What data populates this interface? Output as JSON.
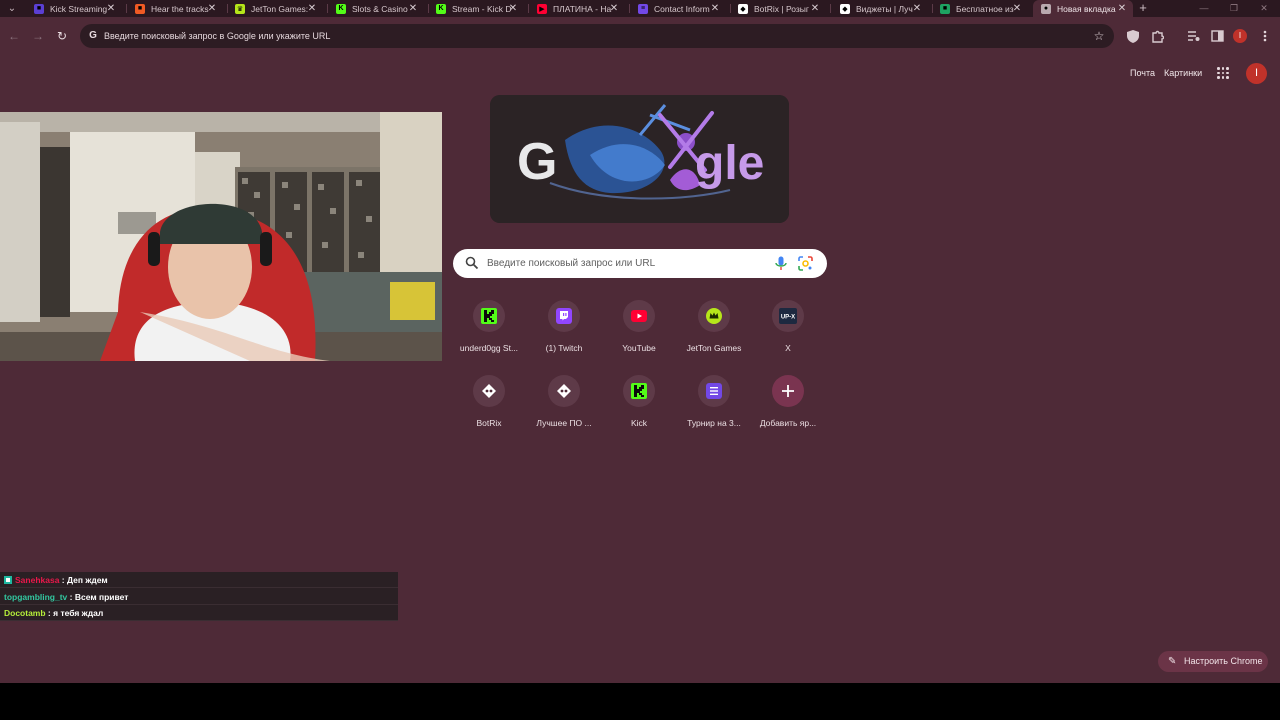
{
  "browser": {
    "tabs": [
      {
        "title": "Kick Streaming",
        "favicon_color": "#5b3fd3",
        "glyph": "■",
        "active": false
      },
      {
        "title": "Hear the tracks",
        "favicon_color": "#f15a24",
        "glyph": "■",
        "active": false
      },
      {
        "title": "JetTon Games:",
        "favicon_color": "#b6e61a",
        "glyph": "♛",
        "active": false
      },
      {
        "title": "Slots & Casino",
        "favicon_color": "#53fc18",
        "glyph": "K",
        "active": false
      },
      {
        "title": "Stream - Kick D",
        "favicon_color": "#53fc18",
        "glyph": "K",
        "active": false
      },
      {
        "title": "ПЛАТИНА - На",
        "favicon_color": "#ff0033",
        "glyph": "▶",
        "active": false
      },
      {
        "title": "Contact Inform",
        "favicon_color": "#7248e6",
        "glyph": "≡",
        "active": false
      },
      {
        "title": "BotRix | Розыг",
        "favicon_color": "#ffffff",
        "glyph": "◆",
        "active": false
      },
      {
        "title": "Виджеты | Луч",
        "favicon_color": "#ffffff",
        "glyph": "◆",
        "active": false
      },
      {
        "title": "Бесплатное из",
        "favicon_color": "#1ea362",
        "glyph": "■",
        "active": false
      },
      {
        "title": "Новая вкладка",
        "favicon_color": "#b9a9af",
        "glyph": "●",
        "active": true
      }
    ],
    "omnibox_placeholder": "Введите поисковый запрос в Google или укажите URL",
    "profile_initial": "I"
  },
  "ntp": {
    "link_mail": "Почта",
    "link_images": "Картинки",
    "avatar_initial": "I",
    "search_placeholder": "Введите поисковый запрос или URL",
    "doodle_letters": [
      "G",
      "g",
      "l",
      "e"
    ],
    "shortcuts": [
      {
        "label": "underd0gg St...",
        "icon": "kick-icon"
      },
      {
        "label": "(1) Twitch",
        "icon": "twitch-icon"
      },
      {
        "label": "YouTube",
        "icon": "youtube-icon"
      },
      {
        "label": "JetTon Games",
        "icon": "jetton-icon"
      },
      {
        "label": "X",
        "icon": "upx-icon"
      },
      {
        "label": "BotRix",
        "icon": "botrix-icon"
      },
      {
        "label": "Лучшее ПО ...",
        "icon": "botrix-icon"
      },
      {
        "label": "Kick",
        "icon": "kick-icon"
      },
      {
        "label": "Турнир на 3...",
        "icon": "list-icon"
      },
      {
        "label": "Добавить яр...",
        "icon": "plus-icon"
      }
    ],
    "customize_label": "Настроить Chrome"
  },
  "chat": {
    "messages": [
      {
        "user": "Sanehkasa",
        "user_color": "#e8184a",
        "text": "Деп ждем",
        "badge": true
      },
      {
        "user": "topgambling_tv",
        "user_color": "#32c8a0",
        "text": "Всем привет",
        "badge": false
      },
      {
        "user": "Docotamb",
        "user_color": "#b6f03a",
        "text": "я тебя ждал",
        "badge": false
      }
    ]
  },
  "colors": {
    "page_bg": "#4e2a37",
    "tabstrip_bg": "#2b1820",
    "omnibox_bg": "#2d1c23",
    "chat_bg": "#2a2024"
  }
}
